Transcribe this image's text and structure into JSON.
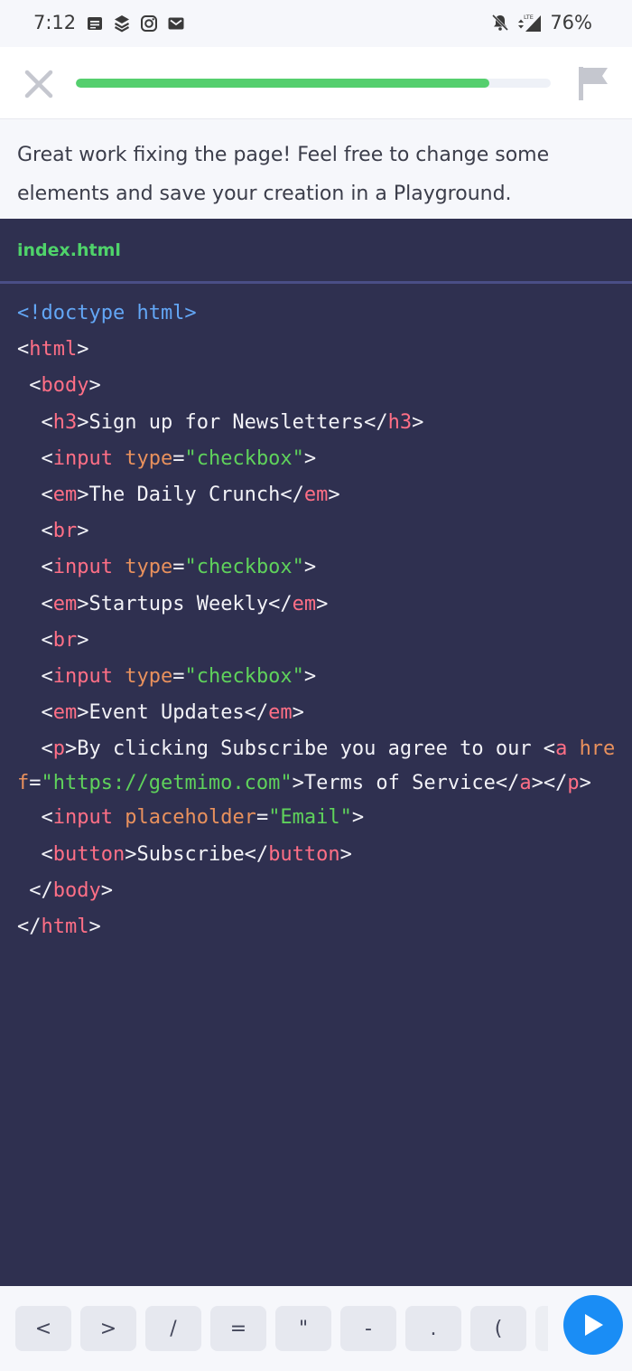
{
  "status_bar": {
    "time": "7:12",
    "icons_left": [
      "notes-icon",
      "layers-icon",
      "instagram-icon",
      "gmail-icon"
    ],
    "battery": "76%",
    "network": "LTE"
  },
  "top_bar": {
    "progress_percent": 87,
    "progress_color": "#55cf6e"
  },
  "message": {
    "text": "Great work fixing the page! Feel free to change some elements and save your creation in a Playground."
  },
  "editor": {
    "file_tab": "index.html",
    "lines": [
      {
        "indent": "",
        "tokens": [
          {
            "t": "doc",
            "v": "<!doctype html>"
          }
        ]
      },
      {
        "indent": "",
        "tokens": [
          {
            "t": "txt",
            "v": "<"
          },
          {
            "t": "tag",
            "v": "html"
          },
          {
            "t": "txt",
            "v": ">"
          }
        ]
      },
      {
        "indent": " ",
        "tokens": [
          {
            "t": "txt",
            "v": "<"
          },
          {
            "t": "tag",
            "v": "body"
          },
          {
            "t": "txt",
            "v": ">"
          }
        ]
      },
      {
        "indent": "  ",
        "tokens": [
          {
            "t": "txt",
            "v": "<"
          },
          {
            "t": "tag",
            "v": "h3"
          },
          {
            "t": "txt",
            "v": ">Sign up for Newsletters</"
          },
          {
            "t": "tag",
            "v": "h3"
          },
          {
            "t": "txt",
            "v": ">"
          }
        ]
      },
      {
        "indent": "  ",
        "tokens": [
          {
            "t": "txt",
            "v": "<"
          },
          {
            "t": "tag",
            "v": "input"
          },
          {
            "t": "txt",
            "v": " "
          },
          {
            "t": "attr",
            "v": "type"
          },
          {
            "t": "txt",
            "v": "="
          },
          {
            "t": "str",
            "v": "\"checkbox\""
          },
          {
            "t": "txt",
            "v": ">"
          }
        ]
      },
      {
        "indent": "  ",
        "tokens": [
          {
            "t": "txt",
            "v": "<"
          },
          {
            "t": "tag",
            "v": "em"
          },
          {
            "t": "txt",
            "v": ">The Daily Crunch</"
          },
          {
            "t": "tag",
            "v": "em"
          },
          {
            "t": "txt",
            "v": ">"
          }
        ]
      },
      {
        "indent": "  ",
        "tokens": [
          {
            "t": "txt",
            "v": "<"
          },
          {
            "t": "tag",
            "v": "br"
          },
          {
            "t": "txt",
            "v": ">"
          }
        ]
      },
      {
        "indent": "  ",
        "tokens": [
          {
            "t": "txt",
            "v": "<"
          },
          {
            "t": "tag",
            "v": "input"
          },
          {
            "t": "txt",
            "v": " "
          },
          {
            "t": "attr",
            "v": "type"
          },
          {
            "t": "txt",
            "v": "="
          },
          {
            "t": "str",
            "v": "\"checkbox\""
          },
          {
            "t": "txt",
            "v": ">"
          }
        ]
      },
      {
        "indent": "  ",
        "tokens": [
          {
            "t": "txt",
            "v": "<"
          },
          {
            "t": "tag",
            "v": "em"
          },
          {
            "t": "txt",
            "v": ">Startups Weekly</"
          },
          {
            "t": "tag",
            "v": "em"
          },
          {
            "t": "txt",
            "v": ">"
          }
        ]
      },
      {
        "indent": "  ",
        "tokens": [
          {
            "t": "txt",
            "v": "<"
          },
          {
            "t": "tag",
            "v": "br"
          },
          {
            "t": "txt",
            "v": ">"
          }
        ]
      },
      {
        "indent": "  ",
        "tokens": [
          {
            "t": "txt",
            "v": "<"
          },
          {
            "t": "tag",
            "v": "input"
          },
          {
            "t": "txt",
            "v": " "
          },
          {
            "t": "attr",
            "v": "type"
          },
          {
            "t": "txt",
            "v": "="
          },
          {
            "t": "str",
            "v": "\"checkbox\""
          },
          {
            "t": "txt",
            "v": ">"
          }
        ]
      },
      {
        "indent": "  ",
        "tokens": [
          {
            "t": "txt",
            "v": "<"
          },
          {
            "t": "tag",
            "v": "em"
          },
          {
            "t": "txt",
            "v": ">Event Updates</"
          },
          {
            "t": "tag",
            "v": "em"
          },
          {
            "t": "txt",
            "v": ">"
          }
        ]
      },
      {
        "indent": "  ",
        "wrap": true,
        "tokens": [
          {
            "t": "txt",
            "v": "<"
          },
          {
            "t": "tag",
            "v": "p"
          },
          {
            "t": "txt",
            "v": ">By clicking Subscribe you agree to our <"
          },
          {
            "t": "tag",
            "v": "a"
          },
          {
            "t": "txt",
            "v": " "
          },
          {
            "t": "attr",
            "v": "href"
          },
          {
            "t": "txt",
            "v": "="
          },
          {
            "t": "str",
            "v": "\"https://getmimo.com\""
          },
          {
            "t": "txt",
            "v": ">Terms of Service</"
          },
          {
            "t": "tag",
            "v": "a"
          },
          {
            "t": "txt",
            "v": "></"
          },
          {
            "t": "tag",
            "v": "p"
          },
          {
            "t": "txt",
            "v": ">"
          }
        ]
      },
      {
        "indent": "  ",
        "tokens": [
          {
            "t": "txt",
            "v": "<"
          },
          {
            "t": "tag",
            "v": "input"
          },
          {
            "t": "txt",
            "v": " "
          },
          {
            "t": "attr",
            "v": "placeholder"
          },
          {
            "t": "txt",
            "v": "="
          },
          {
            "t": "str",
            "v": "\"Email\""
          },
          {
            "t": "txt",
            "v": ">"
          }
        ]
      },
      {
        "indent": "  ",
        "tokens": [
          {
            "t": "txt",
            "v": "<"
          },
          {
            "t": "tag",
            "v": "button"
          },
          {
            "t": "txt",
            "v": ">Subscribe</"
          },
          {
            "t": "tag",
            "v": "button"
          },
          {
            "t": "txt",
            "v": ">"
          }
        ]
      },
      {
        "indent": " ",
        "tokens": [
          {
            "t": "txt",
            "v": "</"
          },
          {
            "t": "tag",
            "v": "body"
          },
          {
            "t": "txt",
            "v": ">"
          }
        ]
      },
      {
        "indent": "",
        "tokens": [
          {
            "t": "txt",
            "v": "</"
          },
          {
            "t": "tag",
            "v": "html"
          },
          {
            "t": "txt",
            "v": ">"
          }
        ]
      }
    ]
  },
  "keybar": {
    "keys": [
      "<",
      ">",
      "/",
      "=",
      "\"",
      "-",
      ".",
      "("
    ],
    "run_color": "#1a8df5"
  }
}
